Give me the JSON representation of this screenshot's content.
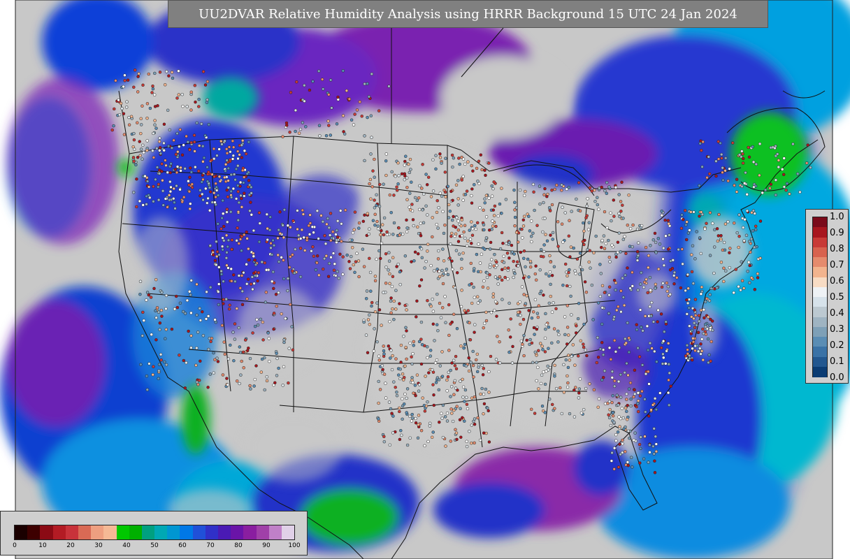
{
  "title": "UU2DVAR Relative Humidity Analysis using HRRR Background 15 UTC 24 Jan 2024",
  "obs_legend": {
    "labels": [
      "1.0",
      "0.9",
      "0.8",
      "0.7",
      "0.6",
      "0.5",
      "0.4",
      "0.3",
      "0.2",
      "0.1",
      "0.0"
    ],
    "colors": [
      "#7a0a1a",
      "#a8161e",
      "#c83a36",
      "#d8624e",
      "#e58b6d",
      "#f2b48e",
      "#f7dcc4",
      "#eef2f5",
      "#d6e2ea",
      "#bcc9d1",
      "#9fb4c2",
      "#7ea0b7",
      "#5a8db4",
      "#3a72a6",
      "#22578f",
      "#0b3c73"
    ]
  },
  "rh_legend": {
    "ticks": [
      "0",
      "10",
      "20",
      "30",
      "40",
      "50",
      "60",
      "70",
      "80",
      "90",
      "100"
    ],
    "colors": [
      "#1a0000",
      "#3d0000",
      "#8b0a14",
      "#b31b24",
      "#c8323a",
      "#d96a55",
      "#ee9f80",
      "#f5b995",
      "#00c800",
      "#00b000",
      "#00a080",
      "#00a8b4",
      "#0096d2",
      "#0078e6",
      "#2050d8",
      "#3030c8",
      "#4a1ab4",
      "#6a14a8",
      "#8a1ea0",
      "#a040a8",
      "#c080c8",
      "#e0d0e8"
    ]
  }
}
